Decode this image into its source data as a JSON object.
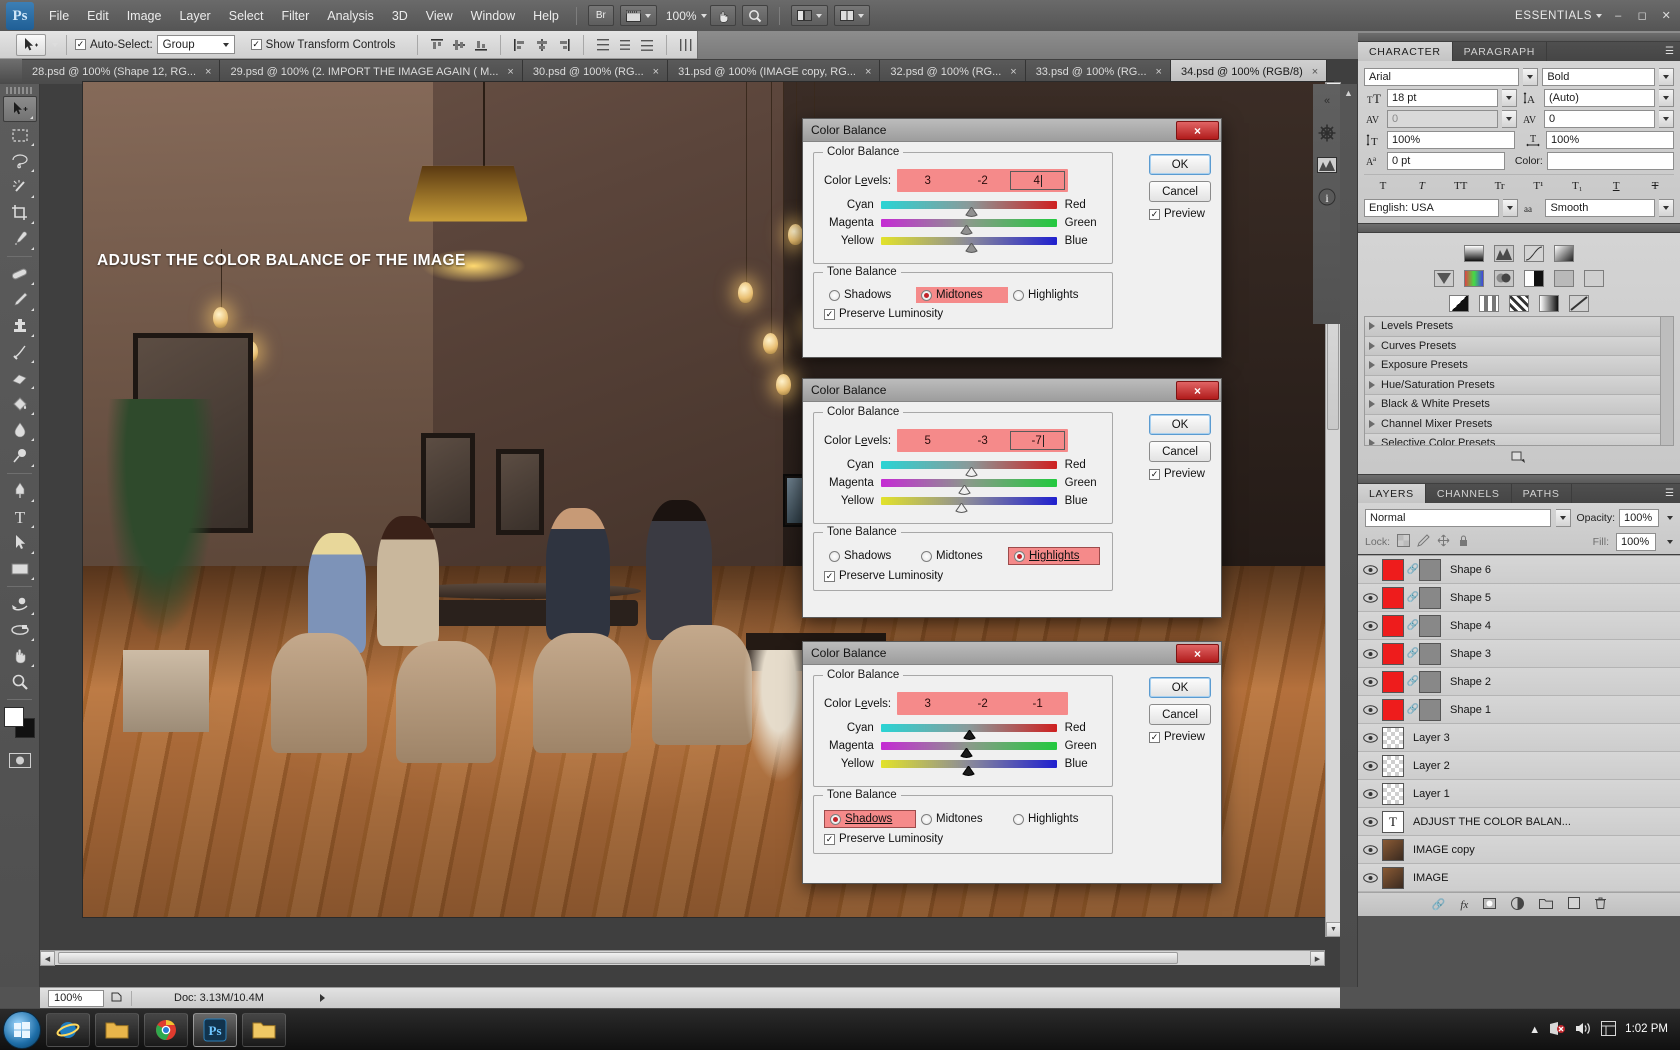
{
  "app": {
    "name": "Adobe Photoshop",
    "logo_text": "Ps",
    "workspace": "ESSENTIALS",
    "zoom_level": "100%",
    "bridge_label": "Br"
  },
  "menubar": {
    "items": [
      "File",
      "Edit",
      "Image",
      "Layer",
      "Select",
      "Filter",
      "Analysis",
      "3D",
      "View",
      "Window",
      "Help"
    ]
  },
  "options_bar": {
    "auto_select_label": "Auto-Select:",
    "auto_select_checked": "✓",
    "auto_select_value": "Group",
    "show_transform_label": "Show Transform Controls",
    "show_transform_checked": "✓"
  },
  "tabs": [
    {
      "label": "28.psd @ 100% (Shape 12, RG...",
      "close": "×",
      "active": false
    },
    {
      "label": "29.psd @ 100% (2. IMPORT THE IMAGE AGAIN ( M...",
      "close": "×",
      "active": false
    },
    {
      "label": "30.psd @ 100% (RG...",
      "close": "×",
      "active": false
    },
    {
      "label": "31.psd @ 100% (IMAGE copy, RG...",
      "close": "×",
      "active": false
    },
    {
      "label": "32.psd @ 100% (RG...",
      "close": "×",
      "active": false
    },
    {
      "label": "33.psd @ 100% (RG...",
      "close": "×",
      "active": false
    },
    {
      "label": "34.psd @ 100% (RGB/8)",
      "close": "×",
      "active": true
    }
  ],
  "toolbox": {
    "tools": [
      "move-tool",
      "rectangular-marquee-tool",
      "lasso-tool",
      "magic-wand-tool",
      "crop-tool",
      "eyedropper-tool",
      "healing-brush-tool",
      "brush-tool",
      "clone-stamp-tool",
      "history-brush-tool",
      "eraser-tool",
      "paint-bucket-tool",
      "blur-tool",
      "dodge-tool",
      "pen-tool",
      "horizontal-type-tool",
      "path-selection-tool",
      "rectangle-tool",
      "3d-rotate-tool",
      "3d-orbit-tool",
      "hand-tool",
      "zoom-tool"
    ],
    "foreground_color": "#ffffff",
    "background_color": "#111111"
  },
  "canvas": {
    "title_text": "ADJUST THE COLOR BALANCE OF THE IMAGE"
  },
  "status_bar": {
    "zoom": "100%",
    "doc_label": "Doc: 3.13M/10.4M"
  },
  "character_panel": {
    "tabs": [
      "CHARACTER",
      "PARAGRAPH"
    ],
    "active_tab": "CHARACTER",
    "font_family": "Arial",
    "font_style": "Bold",
    "font_size": "18 pt",
    "leading": "(Auto)",
    "kerning": "0",
    "tracking": "0",
    "vertical_scale": "100%",
    "horizontal_scale": "100%",
    "baseline_shift": "0 pt",
    "color_label": "Color:",
    "color_value": "#000000",
    "language": "English: USA",
    "anti_alias": "Smooth",
    "style_buttons": [
      "T",
      "T",
      "TT",
      "Tr",
      "T¹",
      "T₁",
      "T",
      "T"
    ]
  },
  "adjustments_panel": {
    "presets": [
      "Levels Presets",
      "Curves Presets",
      "Exposure Presets",
      "Hue/Saturation Presets",
      "Black & White Presets",
      "Channel Mixer Presets",
      "Selective Color Presets"
    ]
  },
  "layers_panel": {
    "tabs": [
      "LAYERS",
      "CHANNELS",
      "PATHS"
    ],
    "active_tab": "LAYERS",
    "blend_mode": "Normal",
    "opacity_label": "Opacity:",
    "opacity_value": "100%",
    "lock_label": "Lock:",
    "fill_label": "Fill:",
    "fill_value": "100%",
    "layers": [
      {
        "name": "Shape 6",
        "type": "shape",
        "visible": true
      },
      {
        "name": "Shape 5",
        "type": "shape",
        "visible": true
      },
      {
        "name": "Shape 4",
        "type": "shape",
        "visible": true
      },
      {
        "name": "Shape 3",
        "type": "shape",
        "visible": true
      },
      {
        "name": "Shape 2",
        "type": "shape",
        "visible": true
      },
      {
        "name": "Shape 1",
        "type": "shape",
        "visible": true
      },
      {
        "name": "Layer 3",
        "type": "pixel",
        "visible": true
      },
      {
        "name": "Layer 2",
        "type": "pixel",
        "visible": true
      },
      {
        "name": "Layer 1",
        "type": "pixel",
        "visible": true
      },
      {
        "name": "ADJUST THE COLOR BALAN...",
        "type": "text",
        "visible": true
      },
      {
        "name": "IMAGE copy",
        "type": "photo",
        "visible": true
      },
      {
        "name": "IMAGE",
        "type": "photo",
        "visible": true
      }
    ]
  },
  "dialogs": [
    {
      "title": "Color Balance",
      "close": "×",
      "group_label": "Color Balance",
      "levels_label": "Color Levels:",
      "levels": [
        "3",
        "-2",
        "4"
      ],
      "focused_index": 2,
      "sliders": [
        {
          "left": "Cyan",
          "right": "Red",
          "pos": 55
        },
        {
          "left": "Magenta",
          "right": "Green",
          "pos": 52
        },
        {
          "left": "Yellow",
          "right": "Blue",
          "pos": 55
        }
      ],
      "tone_label": "Tone Balance",
      "tone_options": [
        "Shadows",
        "Midtones",
        "Highlights"
      ],
      "tone_selected": "Midtones",
      "preserve_label": "Preserve Luminosity",
      "preserve_checked": "✓",
      "ok_label": "OK",
      "cancel_label": "Cancel",
      "preview_label": "Preview",
      "preview_checked": "✓"
    },
    {
      "title": "Color Balance",
      "close": "×",
      "group_label": "Color Balance",
      "levels_label": "Color Levels:",
      "levels": [
        "5",
        "-3",
        "-7"
      ],
      "focused_index": 2,
      "sliders": [
        {
          "left": "Cyan",
          "right": "Red",
          "pos": 55
        },
        {
          "left": "Magenta",
          "right": "Green",
          "pos": 51
        },
        {
          "left": "Yellow",
          "right": "Blue",
          "pos": 48
        }
      ],
      "tone_label": "Tone Balance",
      "tone_options": [
        "Shadows",
        "Midtones",
        "Highlights"
      ],
      "tone_selected": "Highlights",
      "preserve_label": "Preserve Luminosity",
      "preserve_checked": "✓",
      "ok_label": "OK",
      "cancel_label": "Cancel",
      "preview_label": "Preview",
      "preview_checked": "✓"
    },
    {
      "title": "Color Balance",
      "close": "×",
      "group_label": "Color Balance",
      "levels_label": "Color Levels:",
      "levels": [
        "3",
        "-2",
        "-1"
      ],
      "focused_index": -1,
      "sliders": [
        {
          "left": "Cyan",
          "right": "Red",
          "pos": 54
        },
        {
          "left": "Magenta",
          "right": "Green",
          "pos": 52
        },
        {
          "left": "Yellow",
          "right": "Blue",
          "pos": 53
        }
      ],
      "tone_label": "Tone Balance",
      "tone_options": [
        "Shadows",
        "Midtones",
        "Highlights"
      ],
      "tone_selected": "Shadows",
      "preserve_label": "Preserve Luminosity",
      "preserve_checked": "✓",
      "ok_label": "OK",
      "cancel_label": "Cancel",
      "preview_label": "Preview",
      "preview_checked": "✓"
    }
  ],
  "taskbar": {
    "items": [
      "internet-explorer",
      "folder-explorer",
      "google-chrome",
      "photoshop",
      "file-explorer"
    ],
    "clock_time": "1:02 PM"
  }
}
